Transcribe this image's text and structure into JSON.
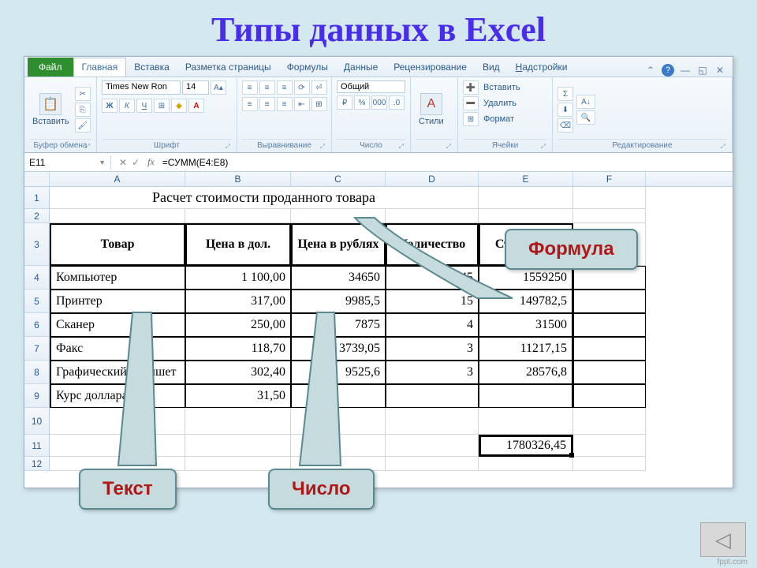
{
  "slide_title": "Типы данных в Excel",
  "tabs": {
    "file": "Файл",
    "home": "Главная",
    "insert": "Вставка",
    "layout": "Разметка страницы",
    "formulas": "Формулы",
    "data": "Данные",
    "review": "Рецензирование",
    "view": "Вид",
    "addins": "Надстройки"
  },
  "ribbon": {
    "clipboard": {
      "paste": "Вставить",
      "label": "Буфер обмена"
    },
    "font": {
      "name": "Times New Ron",
      "size": "14",
      "label": "Шрифт"
    },
    "alignment": {
      "label": "Выравнивание"
    },
    "number": {
      "format": "Общий",
      "label": "Число"
    },
    "styles": {
      "label": "Стили"
    },
    "cells": {
      "insert": "Вставить",
      "delete": "Удалить",
      "format": "Формат",
      "label": "Ячейки"
    },
    "editing": {
      "label": "Редактирование"
    }
  },
  "namebox": "E11",
  "formula": "=СУММ(E4:E8)",
  "columns": [
    "A",
    "B",
    "C",
    "D",
    "E",
    "F"
  ],
  "sheet": {
    "title": "Расчет стоимости проданного товара",
    "headers": [
      "Товар",
      "Цена в дол.",
      "Цена в рублях",
      "Количество",
      "Стоимость"
    ],
    "rows": [
      {
        "n": "4",
        "a": "Компьютер",
        "b": "1 100,00",
        "c": "34650",
        "d": "45",
        "e": "1559250"
      },
      {
        "n": "5",
        "a": "Принтер",
        "b": "317,00",
        "c": "9985,5",
        "d": "15",
        "e": "149782,5"
      },
      {
        "n": "6",
        "a": "Сканер",
        "b": "250,00",
        "c": "7875",
        "d": "4",
        "e": "31500"
      },
      {
        "n": "7",
        "a": "Факс",
        "b": "118,70",
        "c": "3739,05",
        "d": "3",
        "e": "11217,15"
      },
      {
        "n": "8",
        "a": "Графический планшет",
        "b": "302,40",
        "c": "9525,6",
        "d": "3",
        "e": "28576,8"
      },
      {
        "n": "9",
        "a": "Курс доллара",
        "b": "31,50",
        "c": "",
        "d": "",
        "e": ""
      }
    ],
    "total": "1780326,45"
  },
  "callouts": {
    "formula": "Формула",
    "text": "Текст",
    "number": "Число"
  },
  "footer": "fppt.com"
}
